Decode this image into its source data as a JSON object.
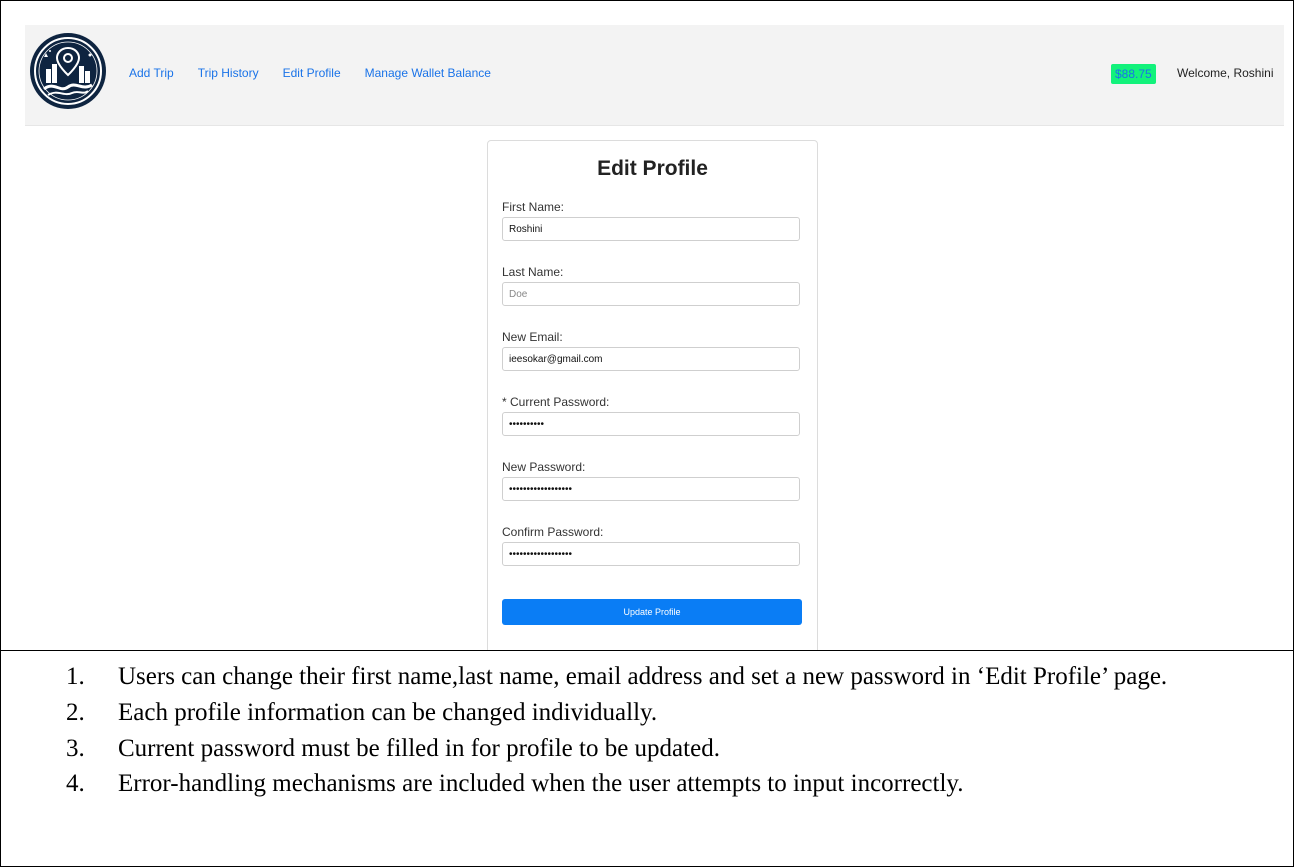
{
  "nav": {
    "links": [
      "Add Trip",
      "Trip History",
      "Edit Profile",
      "Manage Wallet Balance"
    ],
    "wallet_balance": "$88.75",
    "welcome": "Welcome, Roshini",
    "colors": {
      "wallet_bg": "#12f27b",
      "link": "#1a73e8",
      "logo_bg": "#0e2440"
    },
    "logo_icon": "city-map-pin-logo-icon"
  },
  "form": {
    "title": "Edit Profile",
    "first_name": {
      "label": "First Name:",
      "value": "Roshini"
    },
    "last_name": {
      "label": "Last Name:",
      "placeholder": "Doe"
    },
    "email": {
      "label": "New Email:",
      "value": "ieesokar@gmail.com"
    },
    "current_password": {
      "label": "* Current Password:",
      "value": "••••••••••"
    },
    "new_password": {
      "label": "New Password:",
      "value": "••••••••••••••••••"
    },
    "confirm_password": {
      "label": "Confirm Password:",
      "value": "••••••••••••••••••"
    },
    "submit_label": "Update Profile",
    "colors": {
      "button": "#0a7df5"
    }
  },
  "notes": [
    {
      "num": "1.",
      "text": "Users can change their first name,last name, email address and set a new password in ‘Edit Profile’ page."
    },
    {
      "num": "2.",
      "text": "Each profile information can be changed individually."
    },
    {
      "num": "3.",
      "text": "Current password must be filled in for profile to be updated."
    },
    {
      "num": "4.",
      "text": "Error-handling mechanisms are included when the user attempts to input incorrectly."
    }
  ]
}
